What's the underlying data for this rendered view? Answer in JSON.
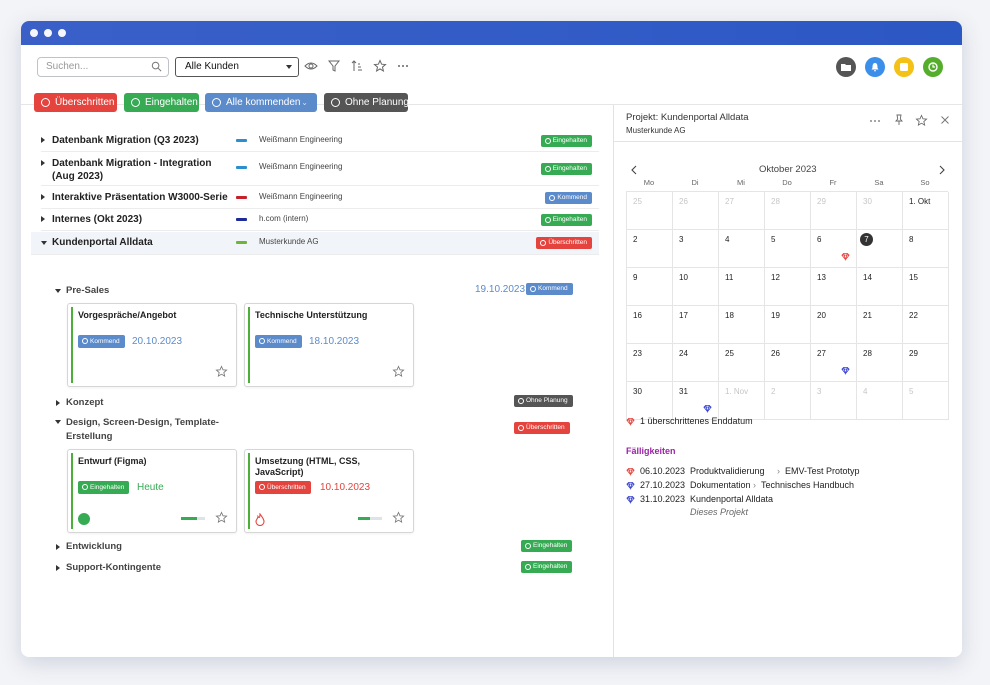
{
  "colors": {
    "red": "#e4443d",
    "green": "#37ab54",
    "blue": "#5b8bcb",
    "dark": "#555555",
    "violet": "#9b23a8"
  },
  "toolbar": {
    "search_placeholder": "Suchen...",
    "customer_select": "Alle Kunden"
  },
  "filters": {
    "ueberschritten": "Überschritten",
    "eingehalten": "Eingehalten",
    "kommend": "Alle kommenden",
    "ohne": "Ohne Planung"
  },
  "projects": [
    {
      "name": "Datenbank Migration (Q3 2023)",
      "customer": "Weißmann Engineering",
      "status": "Eingehalten",
      "bar": "#2b8fcf"
    },
    {
      "name": "Datenbank Migration - Integration (Aug 2023)",
      "customer": "Weißmann Engineering",
      "status": "Eingehalten",
      "bar": "#2b8fcf"
    },
    {
      "name": "Interaktive Präsentation W3000-Serie",
      "customer": "Weißmann Engineering",
      "status": "Kommend",
      "bar": "#c8202a"
    },
    {
      "name": "Internes (Okt 2023)",
      "customer": "h.com (intern)",
      "status": "Eingehalten",
      "bar": "#1c2a9a"
    },
    {
      "name": "Kundenportal Alldata",
      "customer": "Musterkunde AG",
      "status": "Überschritten",
      "bar": "#6fb33a"
    }
  ],
  "phases": {
    "presales": {
      "name": "Pre-Sales",
      "date": "19.10.2023",
      "status": "Kommend"
    },
    "konzept": {
      "name": "Konzept",
      "status": "Ohne Planung"
    },
    "design": {
      "name": "Design, Screen-Design, Template-Erstellung",
      "status": "Überschritten"
    },
    "entwicklung": {
      "name": "Entwicklung",
      "status": "Eingehalten"
    },
    "support": {
      "name": "Support-Kontingente",
      "status": "Eingehalten"
    }
  },
  "cards": [
    {
      "title": "Vorgespräche/Angebot",
      "status": "Kommend",
      "date": "20.10.2023"
    },
    {
      "title": "Technische Unterstützung",
      "status": "Kommend",
      "date": "18.10.2023"
    },
    {
      "title": "Entwurf (Figma)",
      "status": "Eingehalten",
      "date": "Heute",
      "progress": 0.65
    },
    {
      "title": "Umsetzung (HTML, CSS, JavaScript)",
      "status": "Überschritten",
      "date": "10.10.2023",
      "progress": 0.5
    }
  ],
  "panel": {
    "title": "Projekt: Kundenportal Alldata",
    "subtitle": "Musterkunde AG",
    "month": "Oktober 2023",
    "weekdays": [
      "Mo",
      "Di",
      "Mi",
      "Do",
      "Fr",
      "Sa",
      "So"
    ],
    "legend": "1 überschrittenes Enddatum",
    "due_title": "Fälligkeiten",
    "due": [
      {
        "date": "06.10.2023",
        "project": "Produktvalidierung",
        "task": "EMV-Test Prototyp"
      },
      {
        "date": "27.10.2023",
        "project": "Dokumentation",
        "task": "Technisches Handbuch"
      },
      {
        "date": "31.10.2023",
        "project": "Kundenportal Alldata",
        "note": "Dieses Projekt"
      }
    ]
  },
  "calendar": [
    [
      "25",
      "26",
      "27",
      "28",
      "29",
      "30",
      "1. Okt"
    ],
    [
      "2",
      "3",
      "4",
      "5",
      "6",
      "7",
      "8"
    ],
    [
      "9",
      "10",
      "11",
      "12",
      "13",
      "14",
      "15"
    ],
    [
      "16",
      "17",
      "18",
      "19",
      "20",
      "21",
      "22"
    ],
    [
      "23",
      "24",
      "25",
      "26",
      "27",
      "28",
      "29"
    ],
    [
      "30",
      "31",
      "1. Nov",
      "2",
      "3",
      "4",
      "5"
    ]
  ]
}
